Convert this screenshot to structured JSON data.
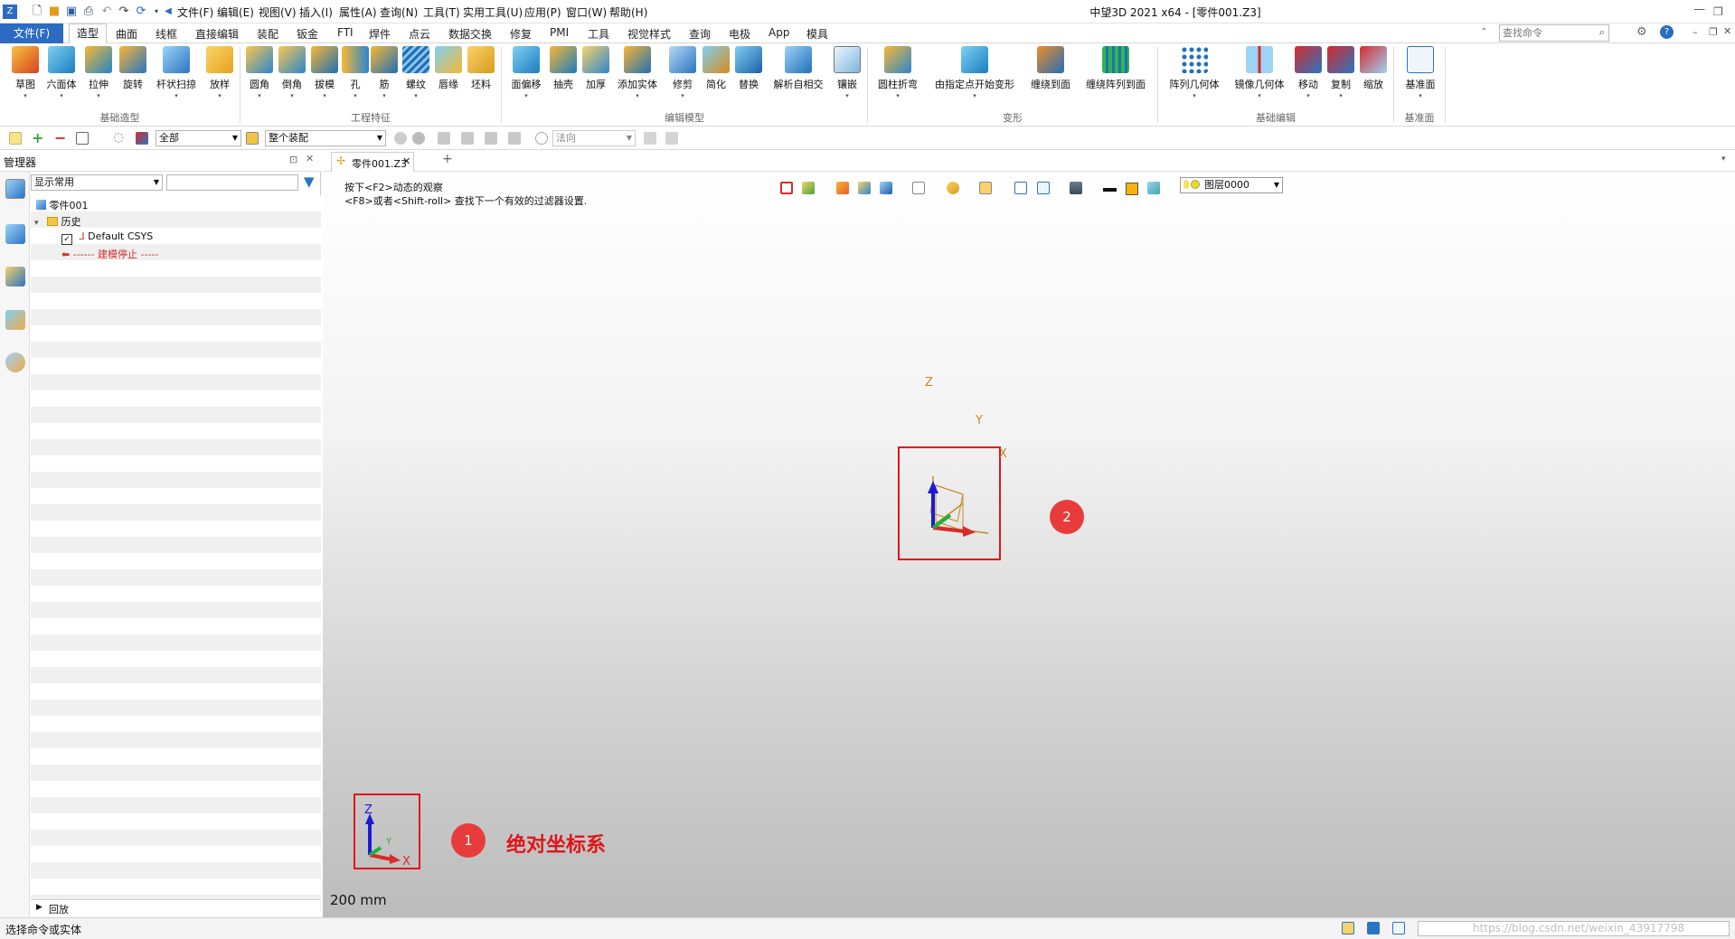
{
  "title_bar": {
    "window_title": "中望3D 2021 x64 - [零件001.Z3]",
    "menus": [
      "文件(F)",
      "编辑(E)",
      "视图(V)",
      "插入(I)",
      "属性(A)",
      "查询(N)",
      "工具(T)",
      "实用工具(U)",
      "应用(P)",
      "窗口(W)",
      "帮助(H)"
    ],
    "search_placeholder": "查找命令"
  },
  "ribbon_tabs": {
    "file": "文件(F)",
    "active": "造型",
    "tabs": [
      "曲面",
      "线框",
      "直接编辑",
      "装配",
      "钣金",
      "FTI",
      "焊件",
      "点云",
      "数据交换",
      "修复",
      "PMI",
      "工具",
      "视觉样式",
      "查询",
      "电极",
      "App",
      "模具"
    ]
  },
  "ribbon": {
    "tools": [
      "草图",
      "六面体",
      "拉伸",
      "旋转",
      "杆状扫掠",
      "放样",
      "圆角",
      "倒角",
      "拔模",
      "孔",
      "筋",
      "螺纹",
      "唇缘",
      "坯料",
      "面偏移",
      "抽壳",
      "加厚",
      "添加实体",
      "修剪",
      "简化",
      "替换",
      "解析自相交",
      "镶嵌",
      "圆柱折弯",
      "由指定点开始变形",
      "缠绕到面",
      "缠绕阵列到面",
      "阵列几何体",
      "镜像几何体",
      "移动",
      "复制",
      "缩放",
      "基准面"
    ],
    "groups": [
      "基础造型",
      "工程特征",
      "编辑模型",
      "变形",
      "基础编辑",
      "基准面"
    ]
  },
  "toolbar2": {
    "filter": "全部",
    "scope": "整个装配",
    "direction": "法向"
  },
  "manager": {
    "title": "管理器",
    "display_filter": "显示常用",
    "tree": {
      "root": "零件001",
      "history": "历史",
      "csys": "Default CSYS",
      "stop": "------ 建模停止 -----"
    },
    "footer": "回放"
  },
  "viewport": {
    "doc_tab": "零件001.Z3",
    "hint1": "按下<F2>动态的观察",
    "hint2": "<F8>或者<Shift-roll> 查找下一个有效的过滤器设置.",
    "layer": "图层0000",
    "scale": "200 mm",
    "annotation_1": "1",
    "annotation_2": "2",
    "annotation_text": "绝对坐标系",
    "axis_x": "X",
    "axis_y": "Y",
    "axis_z": "Z"
  },
  "status": {
    "message": "选择命令或实体",
    "watermark": "https://blog.csdn.net/weixin_43917798"
  },
  "colors": {
    "accent": "#2b6bc2",
    "annotation_red": "#e0151b"
  }
}
